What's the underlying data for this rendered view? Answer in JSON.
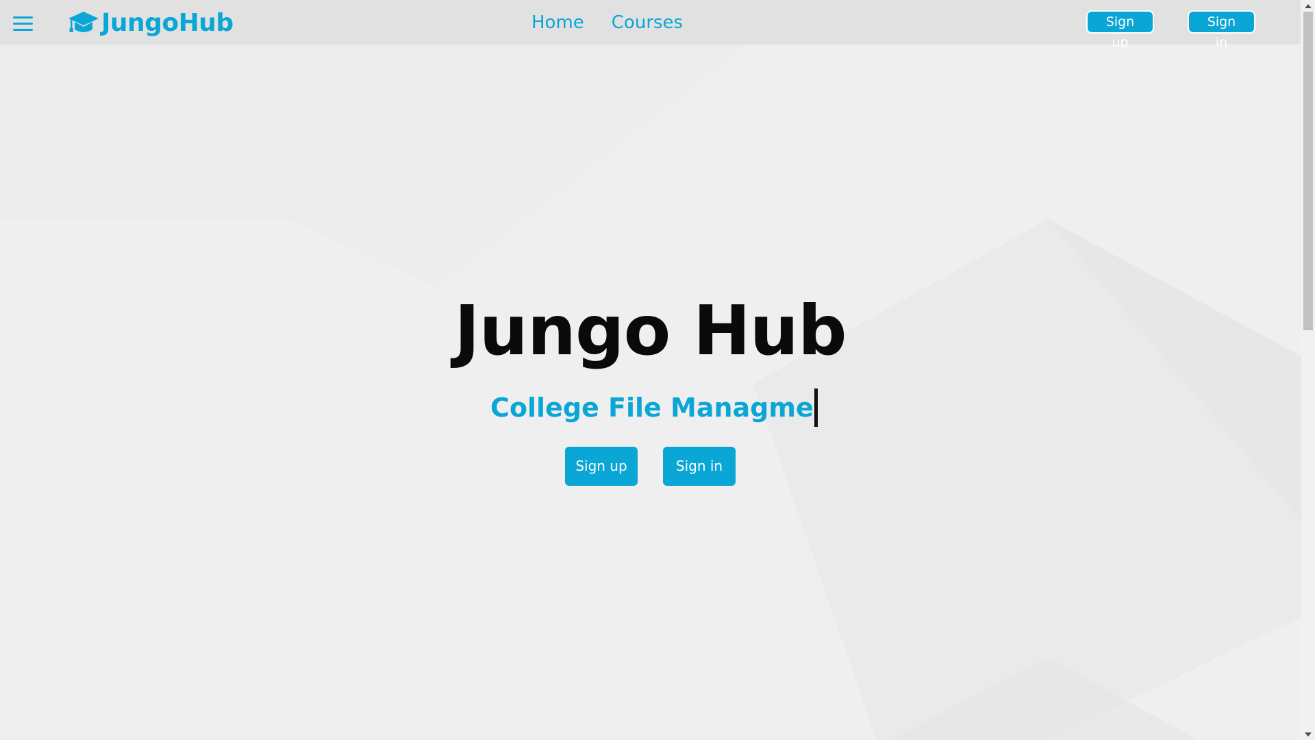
{
  "window": {
    "title": "JungoHub"
  },
  "navbar": {
    "menu_icon": "hamburger-menu-icon",
    "brand": {
      "icon": "graduation-cap-icon",
      "text": "JungoHub"
    },
    "links": [
      {
        "label": "Home"
      },
      {
        "label": "Courses"
      }
    ],
    "signup_label": "Sign up",
    "signin_label": "Sign in"
  },
  "hero": {
    "title": "Jungo Hub",
    "subtitle_typed": "College File Managme",
    "signup_label": "Sign up",
    "signin_label": "Sign in"
  },
  "colors": {
    "accent": "#0aa6d6",
    "navbar_bg": "#e1e1e1",
    "page_bg": "#efefef",
    "title_text": "#0a0a0a",
    "button_text": "#ffffff"
  },
  "scrollbar": {
    "up_icon": "scroll-up-arrow-icon",
    "down_icon": "scroll-down-arrow-icon"
  }
}
